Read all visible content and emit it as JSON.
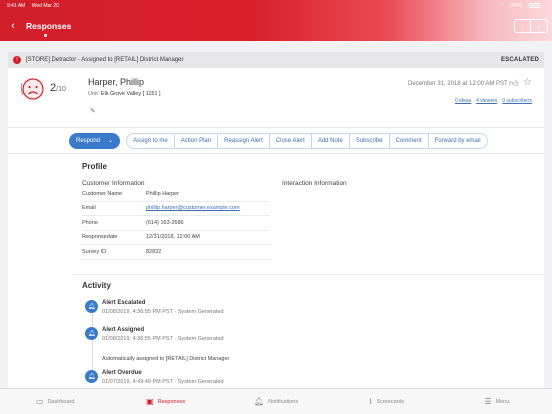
{
  "status_bar": {
    "time": "9:41 AM",
    "date": "Wed Mar 20",
    "battery": "100%"
  },
  "header": {
    "title": "Responses",
    "back_icon": "back-arrow-icon",
    "prev_icon": "chevron-left-icon",
    "next_icon": "chevron-right-icon"
  },
  "banner": {
    "text": "[STORE] Detractor - Assigned to [RETAIL] District Manager",
    "status": "ESCALATED"
  },
  "person": {
    "score": "2",
    "score_max": "/10",
    "name": "Harper, Phillip",
    "unit_label": "Unit:",
    "unit_value": "Elk Grove Valley [ 1151 ]",
    "date": "December 31, 2018 at 12:00 AM PST",
    "ideas": "0 ideas",
    "viewers": "4 viewers",
    "subscribers": "0 subscribers"
  },
  "actions": {
    "respond": "Respond",
    "buttons": [
      "Assign to me",
      "Action Plan",
      "Reassign Alert",
      "Close Alert",
      "Add Note",
      "Subscribe",
      "Comment",
      "Forward by email"
    ]
  },
  "profile": {
    "title": "Profile",
    "customer_info_title": "Customer Information",
    "interaction_info_title": "Interaction Information",
    "rows": [
      {
        "label": "Customer Name",
        "value": "Phillip Harper"
      },
      {
        "label": "Email",
        "value": "phillip.harper@customer.example.com"
      },
      {
        "label": "Phone",
        "value": "(614) 163-2686"
      },
      {
        "label": "Responsedate",
        "value": "12/31/2018, 12:00 AM"
      },
      {
        "label": "Survey ID",
        "value": "82832"
      }
    ]
  },
  "activity": {
    "title": "Activity",
    "items": [
      {
        "title": "Alert Escalated",
        "meta": "01/08/2019, 4:36:55 PM PST · System Generated",
        "note": ""
      },
      {
        "title": "Alert Assigned",
        "meta": "01/08/2019, 4:36:55 PM PST · System Generated",
        "note": "Automatically assigned to [RETAIL] District Manager"
      },
      {
        "title": "Alert Overdue",
        "meta": "01/07/2019, 4:49:49 PM PST · System Generated",
        "note": ""
      }
    ]
  },
  "tabs": [
    {
      "label": "Dashboard",
      "icon": "dashboard-icon"
    },
    {
      "label": "Responses",
      "icon": "responses-icon"
    },
    {
      "label": "Notifications",
      "icon": "bell-icon"
    },
    {
      "label": "Scorecards",
      "icon": "scorecards-icon"
    },
    {
      "label": "Menu",
      "icon": "menu-icon"
    }
  ],
  "colors": {
    "brand": "#d0202b",
    "accent": "#3a7ac9"
  }
}
